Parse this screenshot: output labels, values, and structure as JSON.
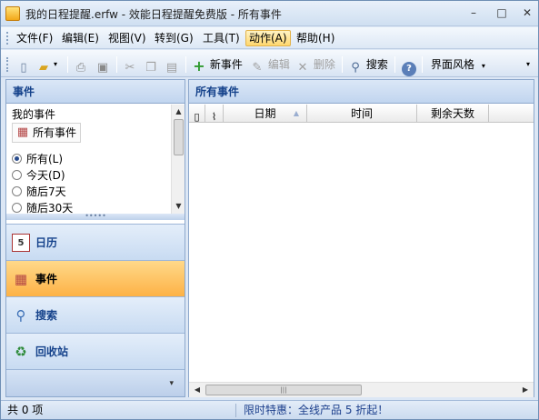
{
  "window": {
    "title": "我的日程提醒.erfw - 效能日程提醒免费版 - 所有事件",
    "minimize": "–",
    "maximize": "□",
    "close": "✕"
  },
  "menu": [
    {
      "label": "文件(F)"
    },
    {
      "label": "编辑(E)"
    },
    {
      "label": "视图(V)"
    },
    {
      "label": "转到(G)"
    },
    {
      "label": "工具(T)"
    },
    {
      "label": "动作(A)"
    },
    {
      "label": "帮助(H)"
    }
  ],
  "toolbar": {
    "new_event": "新事件",
    "edit": "编辑",
    "delete": "删除",
    "search": "搜索",
    "skin": "界面风格",
    "dropdown": "▾"
  },
  "left_pane": {
    "header": "事件",
    "group_label": "我的事件",
    "all_events": "所有事件",
    "filters": [
      "所有(L)",
      "今天(D)",
      "随后7天",
      "随后30天"
    ],
    "splitter": "•••••",
    "nav": [
      "日历",
      "事件",
      "搜索",
      "回收站"
    ],
    "nav_footer": "▾"
  },
  "right_pane": {
    "header": "所有事件",
    "columns": [
      "",
      "",
      "日期",
      "时间",
      "剩余天数"
    ],
    "scroll_grip": "|||"
  },
  "status": {
    "count": "共 0 项",
    "promo": "限时特惠：全线产品 5 折起！"
  },
  "icons": {
    "app": "app-icon",
    "new_doc": "new-document-icon",
    "open": "open-folder-icon",
    "print": "print-icon",
    "preview": "print-preview-icon",
    "cut": "cut-icon",
    "copy": "copy-icon",
    "paste": "paste-icon",
    "add": "add-icon",
    "edit": "edit-icon",
    "delete": "delete-icon",
    "search": "magnifier-icon",
    "help": "help-icon"
  }
}
